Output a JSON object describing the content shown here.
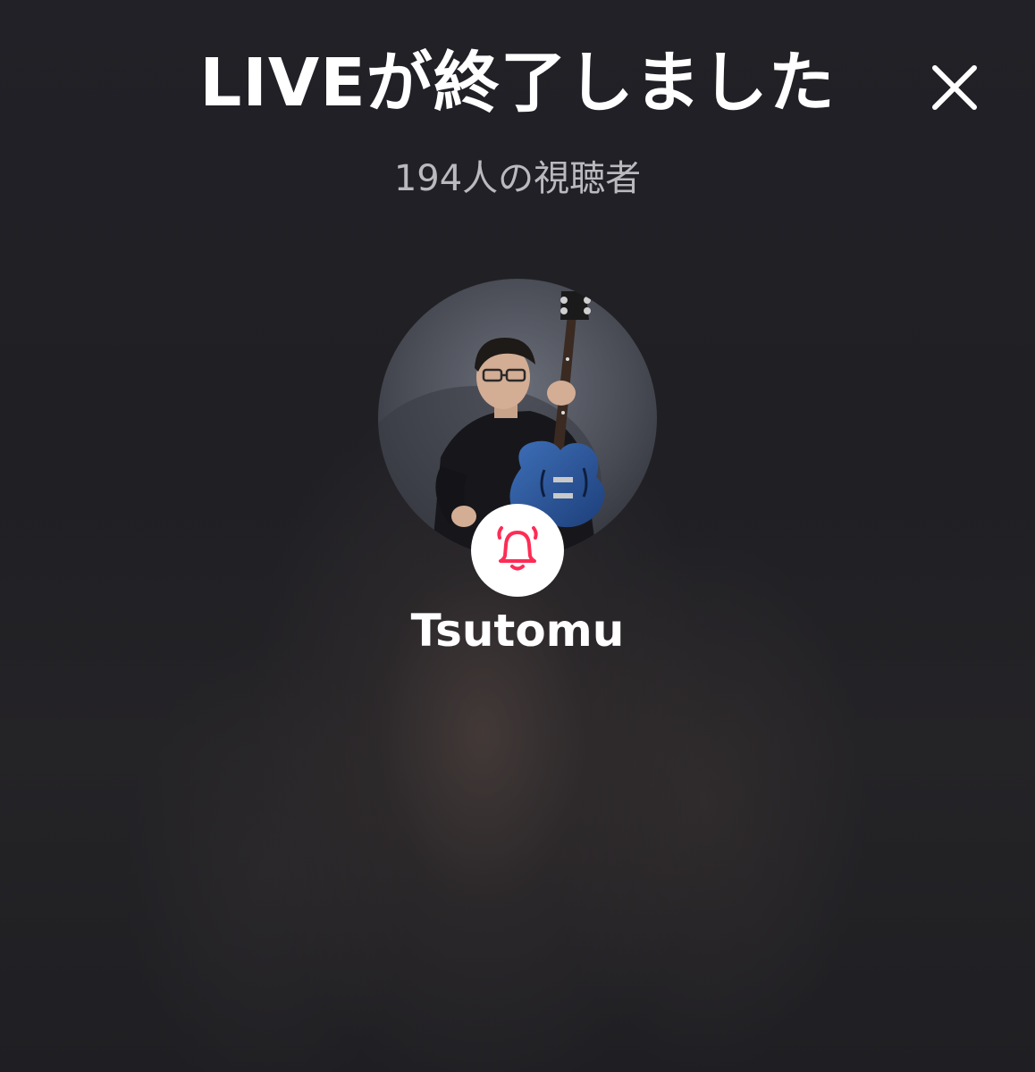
{
  "header": {
    "title": "LIVEが終了しました",
    "close_icon": "close-icon"
  },
  "stats": {
    "viewers_text": "194人の視聴者"
  },
  "host": {
    "username": "Tsutomu",
    "avatar_description_icon": "avatar-photo",
    "notify_icon": "bell-icon"
  },
  "colors": {
    "background": "#1f1f24",
    "title": "#ffffff",
    "subtitle": "#b9b9be",
    "bell_accent": "#fe2c55",
    "bell_bg": "#ffffff"
  }
}
